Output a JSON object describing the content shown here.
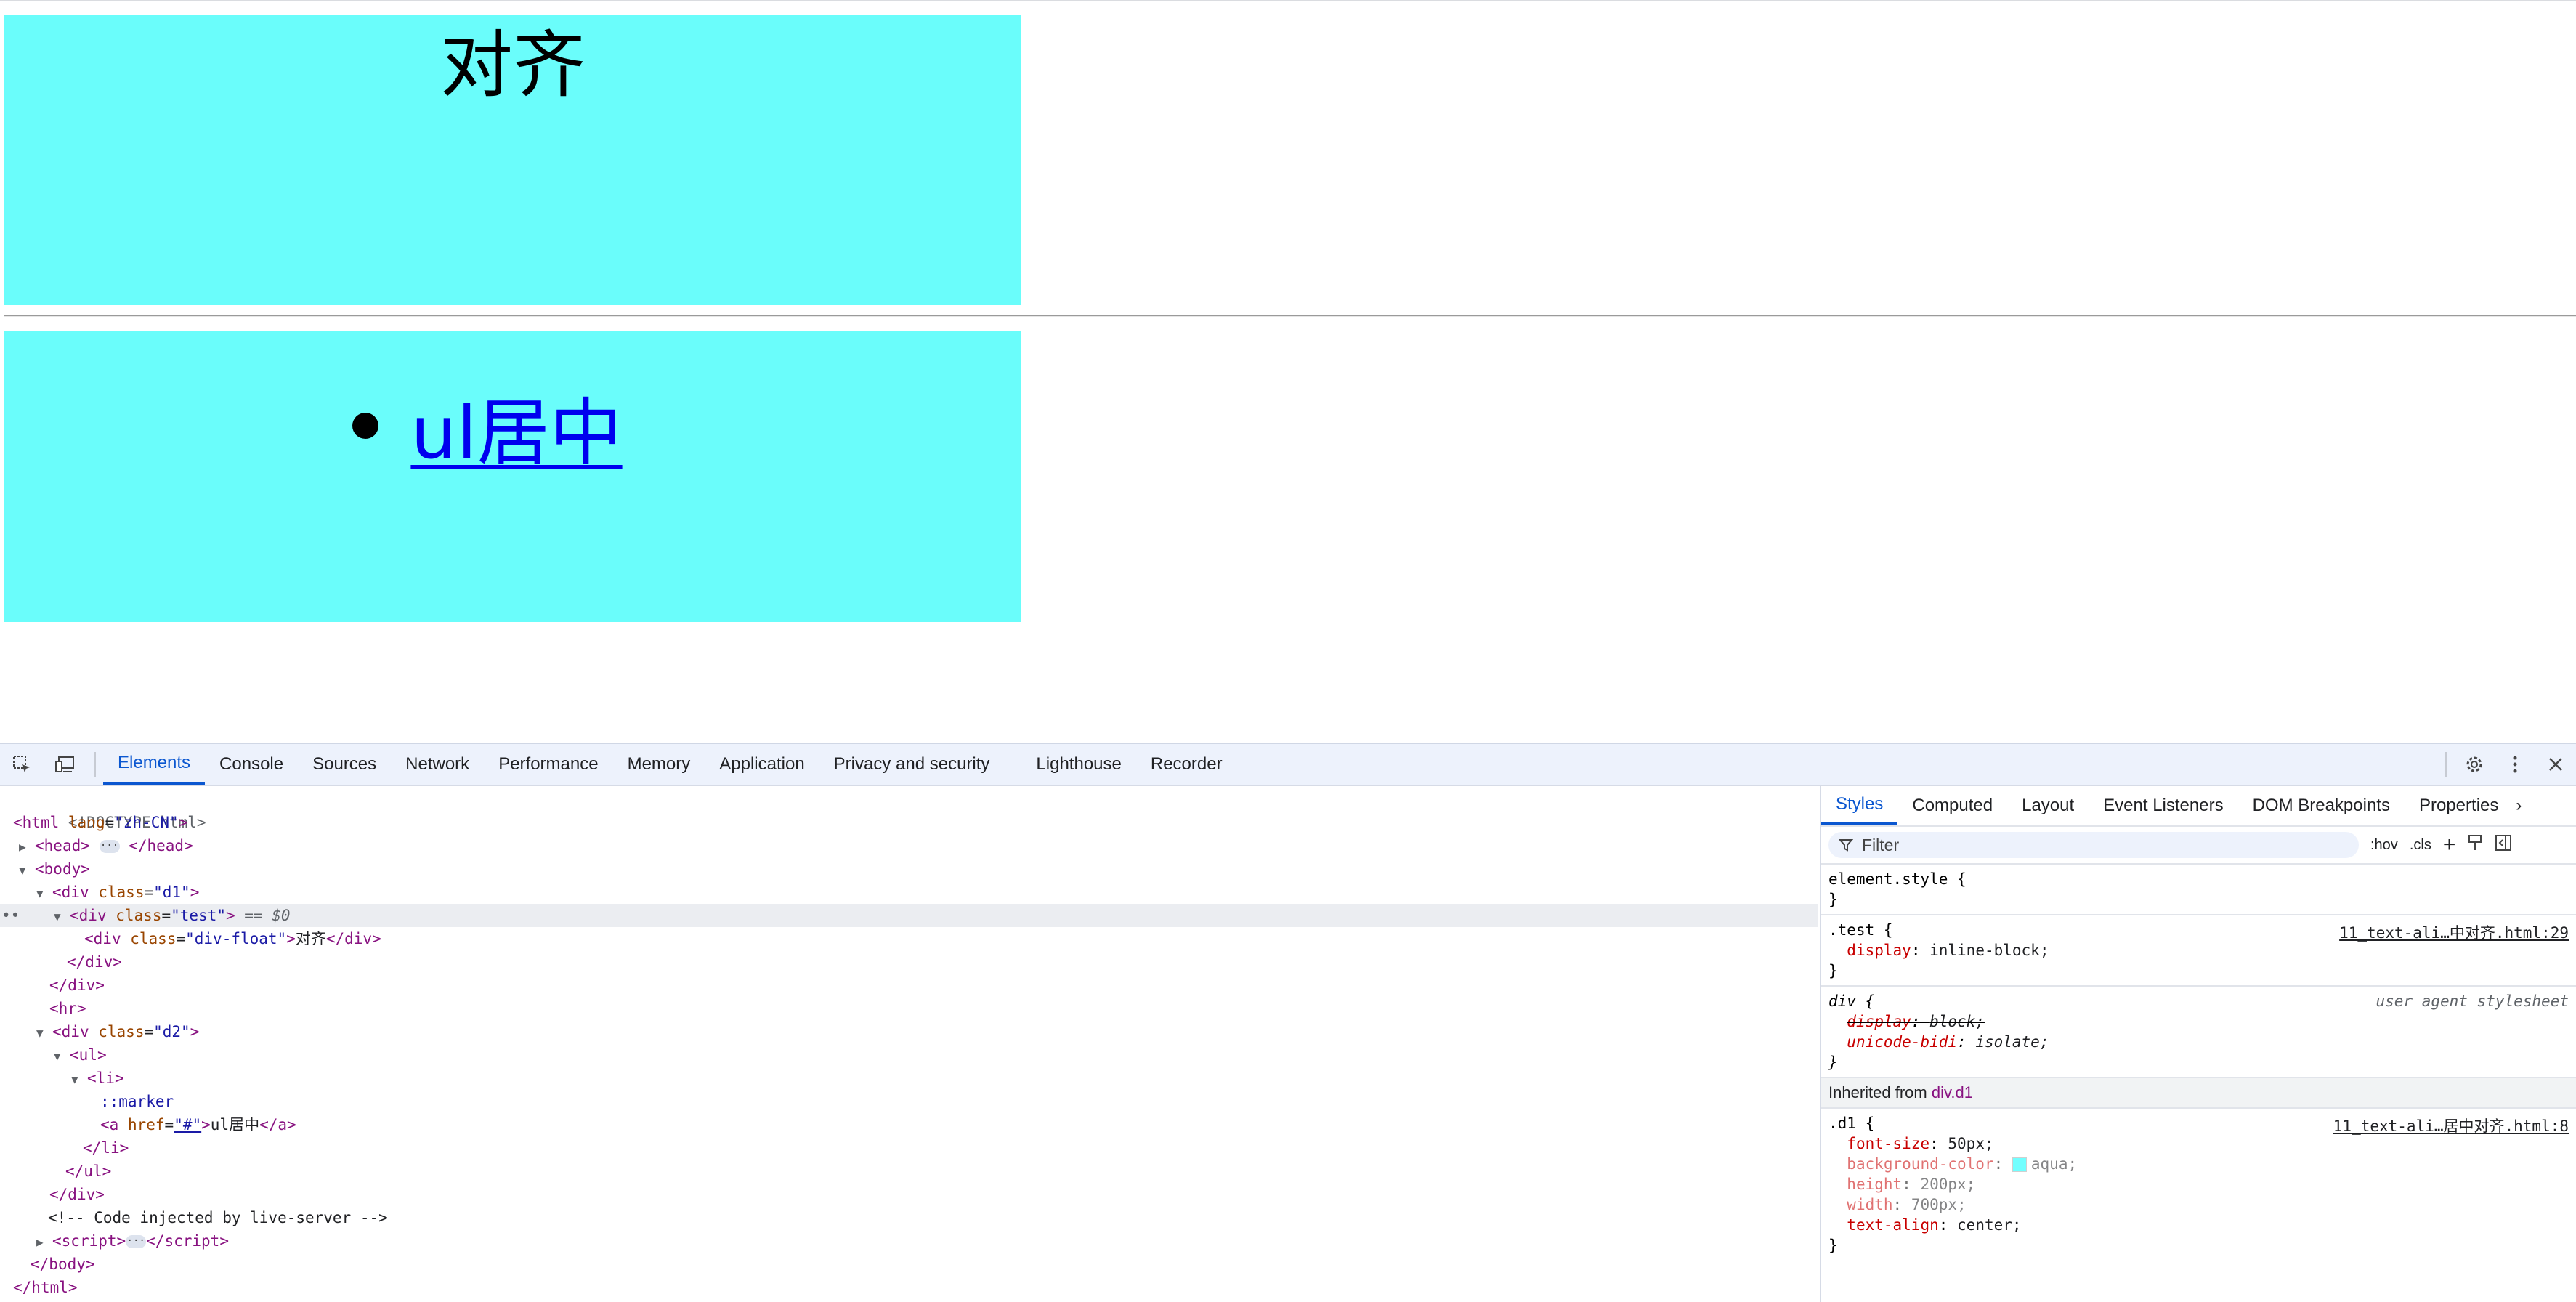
{
  "page": {
    "d1_text": "对齐",
    "d2_link_text": "ul居中",
    "colors": {
      "box_bg": "#6afdfb",
      "link": "#0000ee"
    }
  },
  "devtools": {
    "tabs": [
      "Elements",
      "Console",
      "Sources",
      "Network",
      "Performance",
      "Memory",
      "Application",
      "Privacy and security",
      "Lighthouse",
      "Recorder"
    ],
    "active_tab": "Elements",
    "dom": {
      "doctype": "<!DOCTYPE html>",
      "html_open_tag": "html",
      "html_attr": "lang",
      "html_val": "\"zh-CN\"",
      "head": "head",
      "head_close": "/head",
      "body": "body",
      "d1_tag": "div",
      "d1_attr": "class",
      "d1_val": "\"d1\"",
      "test_tag": "div",
      "test_attr": "class",
      "test_val": "\"test\"",
      "test_eq": " == $0",
      "float_tag": "div",
      "float_attr": "class",
      "float_val": "\"div-float\"",
      "float_text": "对齐",
      "float_close": "/div",
      "div_close": "/div",
      "hr_tag": "hr",
      "d2_tag": "div",
      "d2_attr": "class",
      "d2_val": "\"d2\"",
      "ul_tag": "ul",
      "li_tag": "li",
      "marker": "::marker",
      "a_tag": "a",
      "a_attr": "href",
      "a_val": "\"#\"",
      "a_text": "ul居中",
      "a_close": "/a",
      "li_close": "/li",
      "ul_close": "/ul",
      "comment": "<!-- Code injected by live-server -->",
      "script_tag": "script",
      "script_close": "/script",
      "body_close": "/body",
      "html_close": "/html"
    },
    "styles": {
      "tabs": [
        "Styles",
        "Computed",
        "Layout",
        "Event Listeners",
        "DOM Breakpoints",
        "Properties"
      ],
      "active_tab": "Styles",
      "filter_placeholder": "Filter",
      "hov": ":hov",
      "cls": ".cls",
      "element_style": "element.style {",
      "close_brace": "}",
      "rule_test_selector": ".test {",
      "rule_test_src": "11_text-ali…中对齐.html:29",
      "rule_test_prop": "display",
      "rule_test_val": "inline-block;",
      "rule_div_selector": "div {",
      "rule_div_src": "user agent stylesheet",
      "rule_div_prop1": "display",
      "rule_div_val1": "block;",
      "rule_div_prop2": "unicode-bidi",
      "rule_div_val2": "isolate;",
      "inherited_label": "Inherited from",
      "inherited_link": "div.d1",
      "rule_d1_selector": ".d1 {",
      "rule_d1_src": "11_text-ali…居中对齐.html:8",
      "d1_props": [
        {
          "name": "font-size",
          "value": "50px;"
        },
        {
          "name": "background-color",
          "value": "aqua;"
        },
        {
          "name": "height",
          "value": "200px;"
        },
        {
          "name": "width",
          "value": "700px;"
        },
        {
          "name": "text-align",
          "value": "center;"
        }
      ]
    }
  }
}
